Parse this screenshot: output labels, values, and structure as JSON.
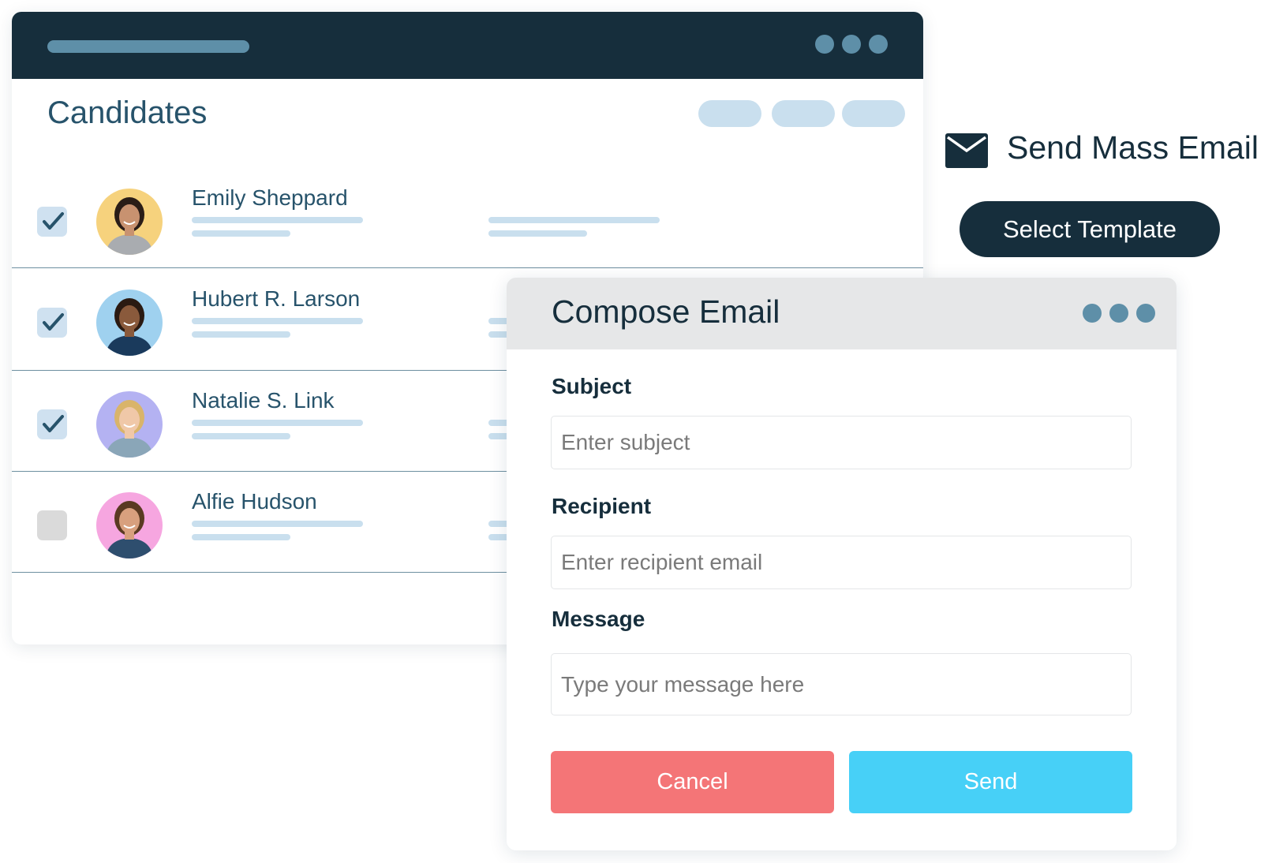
{
  "candidates_panel": {
    "title": "Candidates",
    "rows": [
      {
        "name": "Emily Sheppard",
        "checked": true,
        "avatar_bg": "#f6d27d",
        "avatar_skin": "#c89270",
        "avatar_hair": "#2a1d17",
        "avatar_shirt": "#a9acb0"
      },
      {
        "name": "Hubert R. Larson",
        "checked": true,
        "avatar_bg": "#9fd1ef",
        "avatar_skin": "#8a5a3c",
        "avatar_hair": "#2a1a12",
        "avatar_shirt": "#1a3a5c"
      },
      {
        "name": "Natalie S. Link",
        "checked": true,
        "avatar_bg": "#b4b2f2",
        "avatar_skin": "#f0c8a8",
        "avatar_hair": "#d9b46a",
        "avatar_shirt": "#8aa6b8"
      },
      {
        "name": "Alfie Hudson",
        "checked": false,
        "avatar_bg": "#f6a6e0",
        "avatar_skin": "#d8a07e",
        "avatar_hair": "#5a3a22",
        "avatar_shirt": "#2e4e6e"
      }
    ]
  },
  "mass_email": {
    "icon": "envelope-icon",
    "title": "Send Mass Email",
    "select_template_label": "Select Template"
  },
  "compose": {
    "title": "Compose Email",
    "subject_label": "Subject",
    "subject_placeholder": "Enter subject",
    "recipient_label": "Recipient",
    "recipient_placeholder": "Enter recipient email",
    "message_label": "Message",
    "message_placeholder": "Type your message here",
    "cancel_label": "Cancel",
    "send_label": "Send"
  },
  "colors": {
    "header_dark": "#162e3c",
    "accent_muted": "#5e8fa8",
    "placeholder_light": "#c9dfee",
    "cancel": "#f47577",
    "send": "#47d0f7"
  }
}
